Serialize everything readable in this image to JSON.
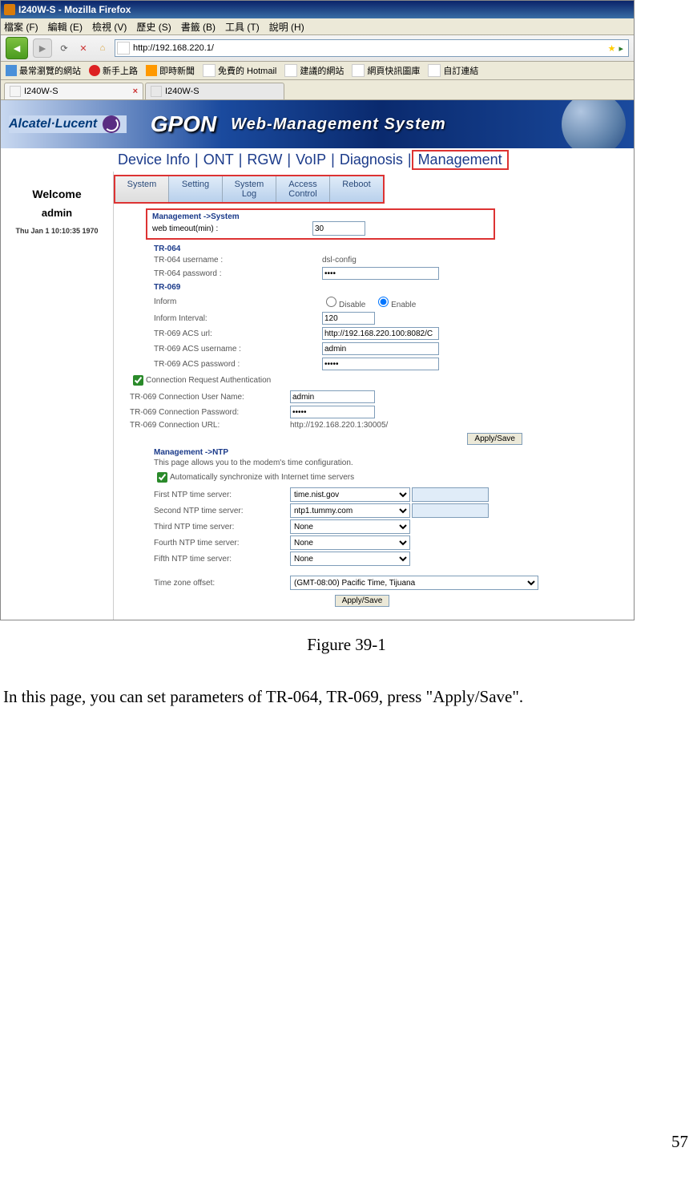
{
  "browser": {
    "title": "I240W-S - Mozilla Firefox",
    "menus": [
      "檔案 (F)",
      "編輯 (E)",
      "檢視 (V)",
      "歷史 (S)",
      "書籤 (B)",
      "工具 (T)",
      "說明 (H)"
    ],
    "url": "http://192.168.220.1/",
    "bookmarks": [
      "最常瀏覽的網站",
      "新手上路",
      "即時新聞",
      "免費的 Hotmail",
      "建議的網站",
      "網頁快訊圖庫",
      "自訂連結"
    ],
    "tabs": [
      "I240W-S",
      "I240W-S"
    ]
  },
  "banner": {
    "brand": "Alcatel·Lucent",
    "product": "GPON",
    "subtitle": "Web-Management System"
  },
  "mainnav": [
    "Device Info",
    "ONT",
    "RGW",
    "VoIP",
    "Diagnosis",
    "Management"
  ],
  "sidebar": {
    "welcome": "Welcome",
    "user": "admin",
    "date": "Thu Jan 1 10:10:35 1970"
  },
  "subtabs": [
    {
      "label": "System",
      "active": true
    },
    {
      "label": "Setting"
    },
    {
      "label": "System\nLog"
    },
    {
      "label": "Access\nControl"
    },
    {
      "label": "Reboot"
    }
  ],
  "system_box": {
    "header": "Management ->System",
    "timeout_label": "web timeout(min) :",
    "timeout_value": "30"
  },
  "tr064": {
    "header": "TR-064",
    "user_label": "TR-064 username :",
    "user_value": "dsl-config",
    "pass_label": "TR-064 password :",
    "pass_value": "****"
  },
  "tr069": {
    "header": "TR-069",
    "inform_label": "Inform",
    "disable": "Disable",
    "enable": "Enable",
    "interval_label": "Inform Interval:",
    "interval_value": "120",
    "acs_url_label": "TR-069 ACS url:",
    "acs_url_value": "http://192.168.220.100:8082/C",
    "acs_user_label": "TR-069 ACS username :",
    "acs_user_value": "admin",
    "acs_pass_label": "TR-069 ACS password :",
    "acs_pass_value": "*****",
    "conn_auth_label": "Connection Request Authentication",
    "conn_user_label": "TR-069 Connection User Name:",
    "conn_user_value": "admin",
    "conn_pass_label": "TR-069 Connection Password:",
    "conn_pass_value": "*****",
    "conn_url_label": "TR-069 Connection URL:",
    "conn_url_value": "http://192.168.220.1:30005/"
  },
  "ntp": {
    "header": "Management ->NTP",
    "desc": "This page allows you to the modem's time configuration.",
    "auto_label": "Automatically synchronize with Internet time servers",
    "servers": [
      {
        "label": "First NTP time server:",
        "value": "time.nist.gov"
      },
      {
        "label": "Second NTP time server:",
        "value": "ntp1.tummy.com"
      },
      {
        "label": "Third NTP time server:",
        "value": "None"
      },
      {
        "label": "Fourth NTP time server:",
        "value": "None"
      },
      {
        "label": "Fifth NTP time server:",
        "value": "None"
      }
    ],
    "tz_label": "Time zone offset:",
    "tz_value": "(GMT-08:00) Pacific Time, Tijuana"
  },
  "buttons": {
    "apply": "Apply/Save"
  },
  "doc": {
    "caption": "Figure 39-1",
    "body": "In this page, you can set parameters of TR-064, TR-069, press \"Apply/Save\".",
    "page": "57"
  }
}
